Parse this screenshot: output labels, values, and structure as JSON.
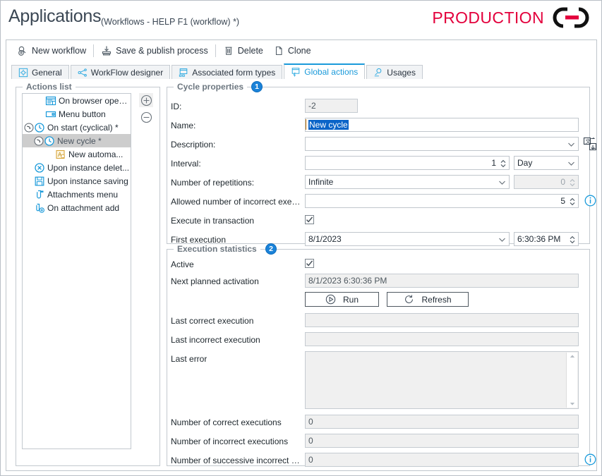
{
  "header": {
    "title": "Applications",
    "subtitle": "(Workflows - HELP F1 (workflow) *)",
    "brand": "PRODUCTION",
    "brand_color": "#e3003c",
    "logo_icon": "chain-link-icon"
  },
  "toolbar": {
    "items": [
      {
        "label": "New workflow",
        "icon": "new-workflow-icon"
      },
      {
        "label": "Save & publish process",
        "icon": "save-publish-icon"
      },
      {
        "label": "Delete",
        "icon": "trash-icon"
      },
      {
        "label": "Clone",
        "icon": "copy-icon"
      }
    ]
  },
  "tabs": [
    {
      "label": "General",
      "icon": "gear-icon",
      "active": false
    },
    {
      "label": "WorkFlow designer",
      "icon": "nodes-icon",
      "active": false
    },
    {
      "label": "Associated form types",
      "icon": "form-types-icon",
      "active": false
    },
    {
      "label": "Global actions",
      "icon": "global-actions-icon",
      "active": true
    },
    {
      "label": "Usages",
      "icon": "usages-icon",
      "active": false
    }
  ],
  "actions_panel": {
    "title": "Actions list",
    "add_button": "add-icon",
    "remove_button": "remove-icon",
    "tree": [
      {
        "label": "On browser opening",
        "icon": "browser-icon",
        "indent": 0,
        "expander": "",
        "selected": false
      },
      {
        "label": "Menu button",
        "icon": "menu-button-icon",
        "indent": 0,
        "expander": "",
        "selected": false
      },
      {
        "label": "On start (cyclical) *",
        "icon": "clock-icon",
        "indent": 0,
        "expander": "collapse",
        "selected": false
      },
      {
        "label": "New cycle *",
        "icon": "clock-icon",
        "indent": 1,
        "expander": "collapse",
        "selected": true
      },
      {
        "label": "New automa...",
        "icon": "automation-icon",
        "indent": 2,
        "expander": "",
        "selected": false
      },
      {
        "label": "Upon instance delet...",
        "icon": "delete-instance-icon",
        "indent": 0,
        "expander": "",
        "selected": false
      },
      {
        "label": "Upon instance saving",
        "icon": "save-icon",
        "indent": 0,
        "expander": "",
        "selected": false
      },
      {
        "label": "Attachments menu",
        "icon": "attachments-menu-icon",
        "indent": 0,
        "expander": "",
        "selected": false
      },
      {
        "label": "On attachment add",
        "icon": "attachment-add-icon",
        "indent": 0,
        "expander": "",
        "selected": false
      }
    ]
  },
  "cycle_properties": {
    "title": "Cycle properties",
    "badge": "1",
    "id_label": "ID:",
    "id_value": "-2",
    "name_label": "Name:",
    "name_value": "New cycle",
    "description_label": "Description:",
    "description_value": "",
    "translate_icon": "translate-icon",
    "interval_label": "Interval:",
    "interval_value": "1",
    "interval_unit": "Day",
    "repetitions_label": "Number of repetitions:",
    "repetitions_value": "Infinite",
    "repetitions_count": "0",
    "allowed_incorrect_label": "Allowed number of incorrect execu...",
    "allowed_incorrect_value": "5",
    "allowed_incorrect_info": "info-icon",
    "transaction_label": "Execute in transaction",
    "transaction_checked": true,
    "first_execution_label": "First execution",
    "first_execution_date": "8/1/2023",
    "first_execution_time": "6:30:36 PM"
  },
  "execution_statistics": {
    "title": "Execution statistics",
    "badge": "2",
    "active_label": "Active",
    "active_checked": true,
    "next_activation_label": "Next planned activation",
    "next_activation_value": "8/1/2023 6:30:36 PM",
    "run_button": "Run",
    "run_icon": "play-icon",
    "refresh_button": "Refresh",
    "refresh_icon": "refresh-icon",
    "last_correct_label": "Last correct execution",
    "last_correct_value": "",
    "last_incorrect_label": "Last incorrect execution",
    "last_incorrect_value": "",
    "last_error_label": "Last error",
    "last_error_value": "",
    "correct_count_label": "Number of correct executions",
    "correct_count_value": "0",
    "incorrect_count_label": "Number of incorrect executions",
    "incorrect_count_value": "0",
    "successive_incorrect_label": "Number of successive incorrect ex...",
    "successive_incorrect_value": "0",
    "successive_info": "info-icon"
  }
}
